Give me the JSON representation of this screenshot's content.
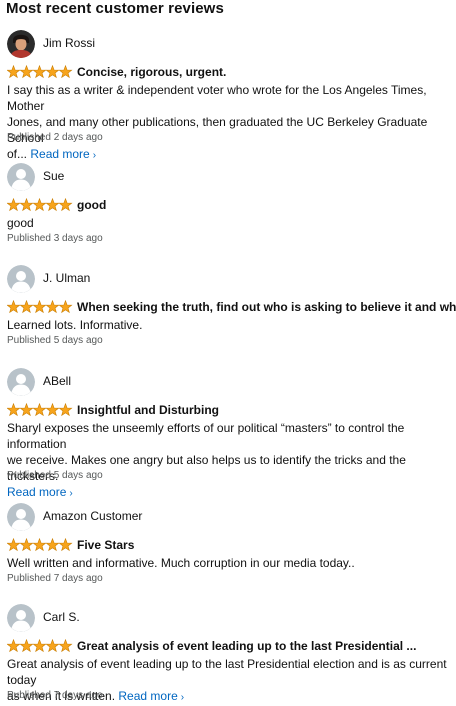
{
  "heading": "Most recent customer reviews",
  "colors": {
    "star": "#f7a41c",
    "link": "#0066c0",
    "avatar_bg": "#b8c2c9"
  },
  "reviews": [
    {
      "reviewer": "Jim Rossi",
      "avatar": "photo-avatar",
      "rating": 5,
      "title": "Concise, rigorous, urgent.",
      "body_lines": [
        "I say this as a writer & independent voter who wrote for the Los Angeles Times, Mother",
        "Jones, and many other publications, then graduated the UC Berkeley Graduate School",
        "of..."
      ],
      "read_more": "Read more",
      "published": "Published 2 days ago"
    },
    {
      "reviewer": "Sue",
      "avatar": "default-avatar",
      "rating": 5,
      "title": "good",
      "body_lines": [
        "good"
      ],
      "published": "Published 3 days ago"
    },
    {
      "reviewer": "J. Ulman",
      "avatar": "default-avatar",
      "rating": 5,
      "title": "When seeking the truth, find out who is asking to believe it and why.",
      "body_lines": [
        "Learned lots. Informative."
      ],
      "published": "Published 5 days ago"
    },
    {
      "reviewer": "ABell",
      "avatar": "default-avatar",
      "rating": 5,
      "title": "Insightful and Disturbing",
      "body_lines": [
        "Sharyl exposes the unseemly efforts of our political “masters” to control the information",
        "we receive. Makes one angry but also helps us to identify the tricks and the tricksters."
      ],
      "read_more": "Read more",
      "published": "Published 5 days ago"
    },
    {
      "reviewer": "Amazon Customer",
      "avatar": "default-avatar",
      "rating": 5,
      "title": "Five Stars",
      "body_lines": [
        "Well written and informative. Much corruption in our media today.."
      ],
      "published": "Published 7 days ago"
    },
    {
      "reviewer": "Carl S.",
      "avatar": "default-avatar",
      "rating": 5,
      "title": "Great analysis of event leading up to the last Presidential ...",
      "body_lines": [
        "Great analysis of event leading up to the last Presidential election and is as current today",
        "as when it is written."
      ],
      "read_more": "Read more",
      "published": "Published 7 days ago"
    }
  ]
}
